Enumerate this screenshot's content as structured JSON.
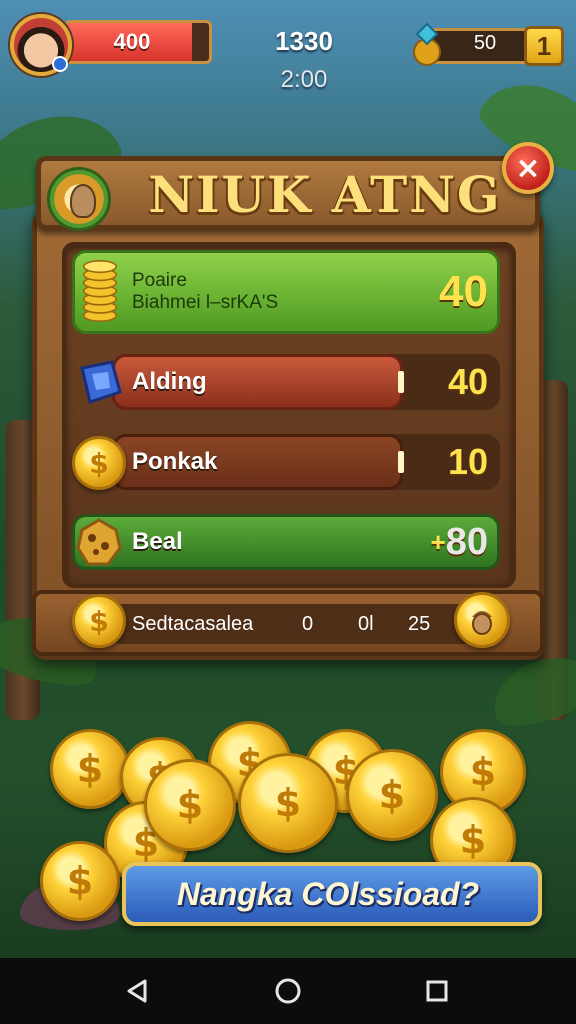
{
  "hud": {
    "health": "400",
    "health_fraction": 0.88,
    "score": "1330",
    "timer": "2:00",
    "gems": "50",
    "level": "1"
  },
  "panel": {
    "title": "NIUK ATNG",
    "close_symbol": "×",
    "rows": [
      {
        "label_line1": "Poaire",
        "label_line2": "Biahmei l–srKA'S",
        "value": "40",
        "icon": "coin-stack-icon"
      },
      {
        "label": "Alding",
        "value": "40",
        "value_prefix": "",
        "icon": "blue-gem-icon",
        "fill_fraction": 0.75
      },
      {
        "label": "Ponkak",
        "value": "10",
        "icon": "dollar-coin-icon",
        "fill_fraction": 0.75
      },
      {
        "label": "Beal",
        "value": "80",
        "value_prefix": "+",
        "icon": "cookie-icon"
      }
    ],
    "footer": {
      "label": "Sedtacasalea",
      "numbers": [
        "0",
        "0l",
        "25"
      ]
    }
  },
  "coin_symbol": "$",
  "banner": {
    "text": "Nangka COlssioad?"
  },
  "navbar": {
    "back": "◁",
    "home": "○",
    "recents": "□"
  },
  "colors": {
    "accent_gold": "#ffe24d",
    "row_green": "#5cab3a",
    "row_red": "#c95a3a",
    "close_red": "#c0211a",
    "banner_blue": "#2b5cb8"
  }
}
